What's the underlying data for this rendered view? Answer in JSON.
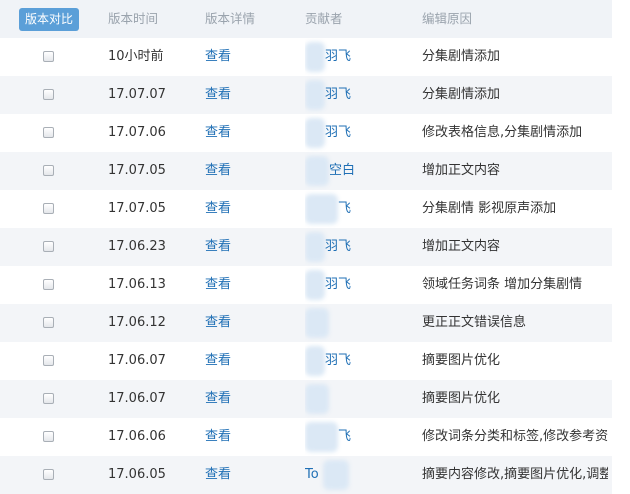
{
  "header": {
    "compare_button": "版本对比",
    "col_time": "版本时间",
    "col_detail": "版本详情",
    "col_contributor": "贡献者",
    "col_reason": "编辑原因"
  },
  "rows": [
    {
      "time": "10小时前",
      "detail": "查看",
      "contributor": "羽飞",
      "reason": "分集剧情添加"
    },
    {
      "time": "17.07.07",
      "detail": "查看",
      "contributor": "羽飞",
      "reason": "分集剧情添加"
    },
    {
      "time": "17.07.06",
      "detail": "查看",
      "contributor": "羽飞",
      "reason": "修改表格信息,分集剧情添加"
    },
    {
      "time": "17.07.05",
      "detail": "查看",
      "contributor": "空白",
      "reason": "增加正文内容"
    },
    {
      "time": "17.07.05",
      "detail": "查看",
      "contributor": "飞",
      "reason": "分集剧情 影视原声添加"
    },
    {
      "time": "17.06.23",
      "detail": "查看",
      "contributor": "羽飞",
      "reason": "增加正文内容"
    },
    {
      "time": "17.06.13",
      "detail": "查看",
      "contributor": "羽飞",
      "reason": "领域任务词条 增加分集剧情"
    },
    {
      "time": "17.06.12",
      "detail": "查看",
      "contributor": "",
      "reason": "更正正文错误信息"
    },
    {
      "time": "17.06.07",
      "detail": "查看",
      "contributor": "羽飞",
      "reason": "摘要图片优化"
    },
    {
      "time": "17.06.07",
      "detail": "查看",
      "contributor": "",
      "reason": "摘要图片优化"
    },
    {
      "time": "17.06.06",
      "detail": "查看",
      "contributor": "飞",
      "reason": "修改词条分类和标签,修改参考资..."
    },
    {
      "time": "17.06.05",
      "detail": "查看",
      "contributor": "To",
      "reason": "摘要内容修改,摘要图片优化,调整..."
    }
  ]
}
